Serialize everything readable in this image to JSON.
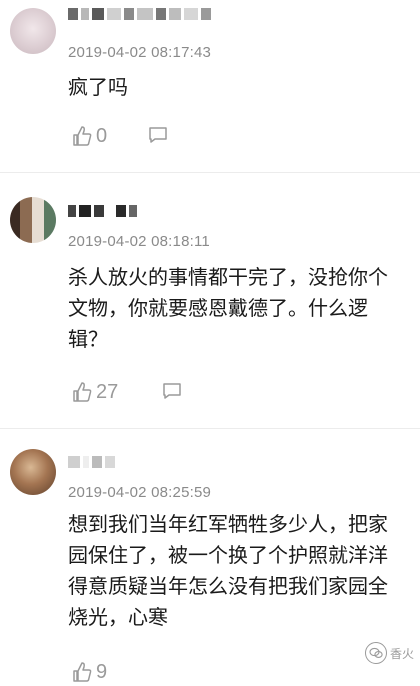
{
  "comments": [
    {
      "timestamp": "2019-04-02 08:17:43",
      "text": "疯了吗",
      "likes": "0"
    },
    {
      "timestamp": "2019-04-02 08:18:11",
      "text": "杀人放火的事情都干完了，没抢你个文物，你就要感恩戴德了。什么逻辑？",
      "likes": "27"
    },
    {
      "timestamp": "2019-04-02 08:25:59",
      "text": "想到我们当年红军牺牲多少人，把家园保住了，被一个换了个护照就洋洋得意质疑当年怎么没有把我们家园全烧光，心寒",
      "likes": "9"
    }
  ],
  "watermark": {
    "text": "香火"
  },
  "icons": {
    "like": "thumbs-up-icon",
    "reply": "comment-bubble-icon",
    "watermark": "wechat-logo-icon"
  },
  "colors": {
    "timestamp": "#8a8a8a",
    "text": "#1a1a1a",
    "icon": "#9a9a9a"
  }
}
